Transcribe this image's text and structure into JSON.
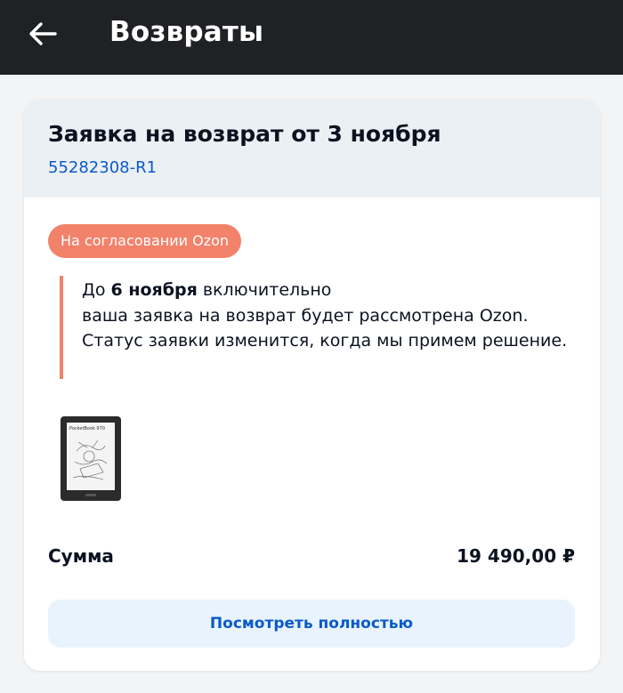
{
  "header": {
    "title": "Возвраты",
    "back_icon": "arrow-left-icon"
  },
  "return_request": {
    "title": "Заявка на возврат от 3 ноября",
    "order_id": "55282308-R1",
    "status": "На согласовании Ozon",
    "info": {
      "prefix": "До",
      "deadline": "6 ноября",
      "line1_suffix": "включительно",
      "rest": "ваша заявка на возврат будет рассмотрена Ozon. Статус заявки изменится, когда мы примем решение."
    },
    "product": {
      "thumbnail_brand": "PocketBook 970"
    },
    "sum": {
      "label": "Сумма",
      "value": "19 490,00 ₽"
    },
    "view_button": "Посмотреть полностью"
  },
  "colors": {
    "topbar": "#1f2124",
    "accent_blue": "#0a5ac8",
    "status_badge": "#f3826b",
    "header_bg": "#ebf0f5"
  }
}
